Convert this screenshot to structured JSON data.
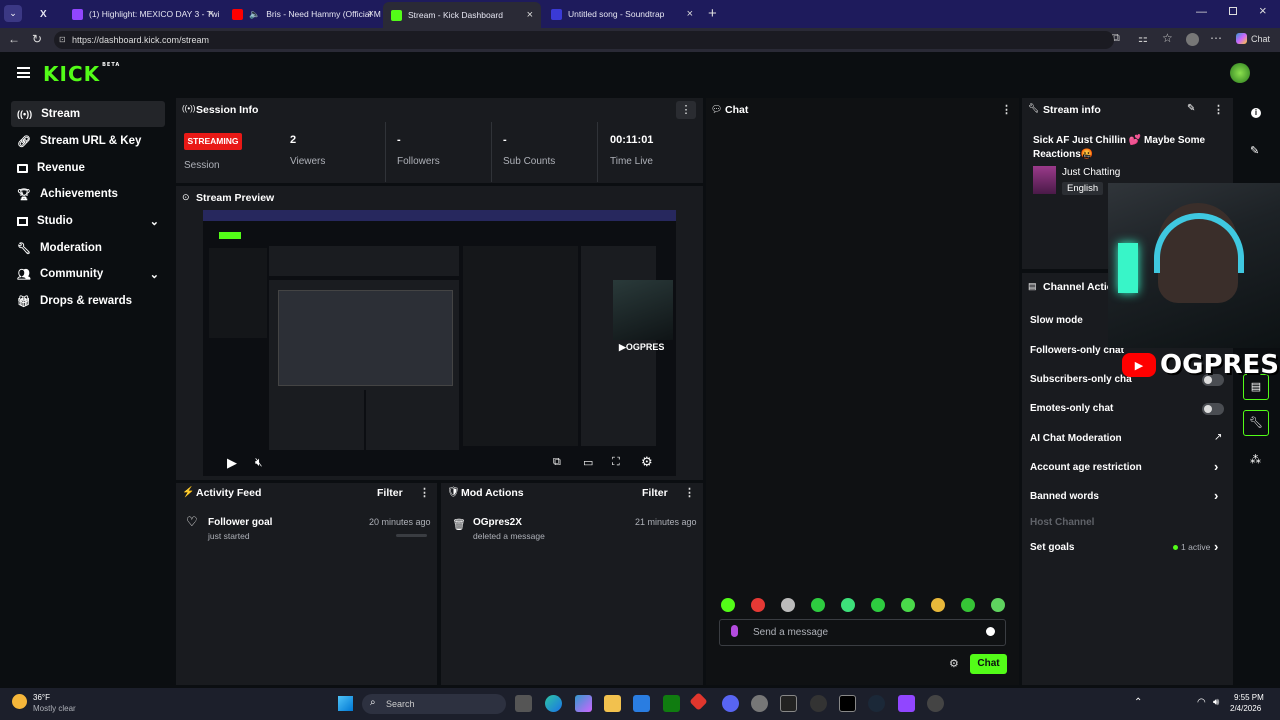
{
  "browser": {
    "tabs": [
      {
        "label": "X"
      },
      {
        "label": "(1) Highlight: MEXICO DAY 3 - Twi"
      },
      {
        "label": "Bris - Need Hammy (Official M"
      },
      {
        "label": "Stream - Kick Dashboard",
        "active": true
      },
      {
        "label": "Untitled song - Soundtrap"
      }
    ],
    "url": "https://dashboard.kick.com/stream",
    "chat_button": "Chat"
  },
  "logo_text": "KICK",
  "logo_badge": "BETA",
  "sidebar": {
    "items": [
      {
        "label": "Stream",
        "icon": "broadcast-icon",
        "active": true
      },
      {
        "label": "Stream URL & Key",
        "icon": "link-icon"
      },
      {
        "label": "Revenue",
        "icon": "revenue-icon"
      },
      {
        "label": "Achievements",
        "icon": "trophy-icon"
      },
      {
        "label": "Studio",
        "icon": "studio-icon",
        "expandable": true
      },
      {
        "label": "Moderation",
        "icon": "wrench-icon"
      },
      {
        "label": "Community",
        "icon": "community-icon",
        "expandable": true
      },
      {
        "label": "Drops & rewards",
        "icon": "drops-icon"
      }
    ]
  },
  "session": {
    "title": "Session Info",
    "badge": "STREAMING",
    "badge_label": "Session",
    "stats": [
      {
        "value": "2",
        "label": "Viewers"
      },
      {
        "value": "-",
        "label": "Followers"
      },
      {
        "value": "-",
        "label": "Sub Counts"
      },
      {
        "value": "00:11:01",
        "label": "Time Live"
      }
    ]
  },
  "preview": {
    "title": "Stream Preview"
  },
  "activity": {
    "title": "Activity Feed",
    "filter": "Filter",
    "items": [
      {
        "title": "Follower goal",
        "sub": "just started",
        "time": "20 minutes ago"
      }
    ]
  },
  "mod_actions": {
    "title": "Mod Actions",
    "filter": "Filter",
    "items": [
      {
        "title": "OGpres2X",
        "sub": "deleted a message",
        "time": "21 minutes ago"
      }
    ]
  },
  "chat": {
    "title": "Chat",
    "placeholder": "Send a message",
    "send": "Chat"
  },
  "stream_info": {
    "title": "Stream info",
    "stream_title": "Sick AF Just Chillin 💕 Maybe Some Reactions🤬",
    "category": "Just Chatting",
    "language": "English"
  },
  "channel_actions": {
    "title": "Channel Actio",
    "rows": [
      {
        "label": "Slow mode"
      },
      {
        "label": "Followers-only chat"
      },
      {
        "label": "Subscribers-only cha"
      },
      {
        "label": "Emotes-only chat"
      },
      {
        "label": "AI Chat Moderation"
      },
      {
        "label": "Account age restriction"
      },
      {
        "label": "Banned words"
      },
      {
        "label": "Host Channel"
      },
      {
        "label": "Set goals"
      }
    ],
    "goals_active": "1 active"
  },
  "overlay": {
    "brand": "OGPRES"
  },
  "taskbar": {
    "weather_temp": "36°F",
    "weather_desc": "Mostly clear",
    "search": "Search",
    "time": "9:55 PM",
    "date": "2/4/2026"
  },
  "colors": {
    "accent": "#53fc18",
    "live": "#e91916",
    "panel": "#191b1f",
    "bg": "#0b0e11"
  }
}
